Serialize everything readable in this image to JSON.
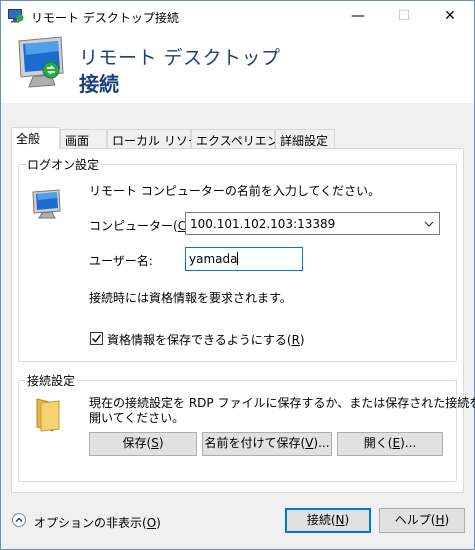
{
  "window": {
    "title": "リモート デスクトップ接続",
    "minimize_glyph": "—",
    "maximize_glyph": "☐",
    "close_glyph": "✕"
  },
  "banner": {
    "line1": "リモート デスクトップ",
    "line2": "接続"
  },
  "tabs": [
    {
      "label": "全般",
      "active": true
    },
    {
      "label": "画面",
      "active": false
    },
    {
      "label": "ローカル リソース",
      "active": false
    },
    {
      "label": "エクスペリエンス",
      "active": false
    },
    {
      "label": "詳細設定",
      "active": false
    }
  ],
  "logon": {
    "group_title": "ログオン設定",
    "instruction": "リモート コンピューターの名前を入力してください。",
    "computer_label_pre": "コンピューター(",
    "computer_label_key": "C",
    "computer_label_post": "):",
    "computer_value": "100.101.102.103:13389",
    "username_label": "ユーザー名:",
    "username_value": "yamada",
    "credential_note": "接続時には資格情報を要求されます。",
    "save_credentials_pre": "資格情報を保存できるようにする(",
    "save_credentials_key": "R",
    "save_credentials_post": ")",
    "save_credentials_checked": true
  },
  "connection": {
    "group_title": "接続設定",
    "description_line1": "現在の接続設定を RDP ファイルに保存するか、または保存された接続を",
    "description_line2": "開いてください。",
    "save_pre": "保存(",
    "save_key": "S",
    "save_post": ")",
    "save_as_pre": "名前を付けて保存(",
    "save_as_key": "V",
    "save_as_post": ")...",
    "open_pre": "開く(",
    "open_key": "E",
    "open_post": ")..."
  },
  "footer": {
    "hide_options_pre": "オプションの非表示(",
    "hide_options_key": "O",
    "hide_options_post": ")",
    "connect_pre": "接続(",
    "connect_key": "N",
    "connect_post": ")",
    "help_pre": "ヘルプ(",
    "help_key": "H",
    "help_post": ")"
  },
  "colors": {
    "banner_text": "#1d3f7c",
    "focus_border": "#0078d7",
    "dialog_bg": "#f0f0f0"
  }
}
